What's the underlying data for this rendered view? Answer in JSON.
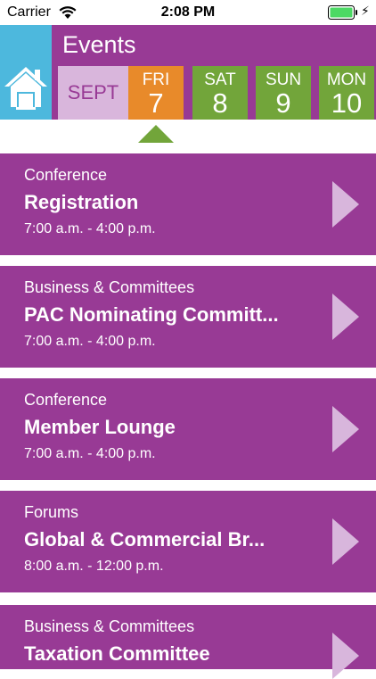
{
  "status_bar": {
    "carrier": "Carrier",
    "time": "2:08 PM"
  },
  "header": {
    "title": "Events",
    "home_icon": "home-icon"
  },
  "date_strip": {
    "month": "SEPT",
    "days": [
      {
        "dow": "FRI",
        "num": "7",
        "color": "#e88a2a",
        "selected": true
      },
      {
        "dow": "SAT",
        "num": "8",
        "color": "#72a53a",
        "selected": false
      },
      {
        "dow": "SUN",
        "num": "9",
        "color": "#72a53a",
        "selected": false
      },
      {
        "dow": "MON",
        "num": "10",
        "color": "#72a53a",
        "selected": false
      }
    ]
  },
  "events": [
    {
      "category": "Conference",
      "title": "Registration",
      "time": "7:00 a.m. - 4:00 p.m."
    },
    {
      "category": "Business & Committees",
      "title": "PAC Nominating Committ...",
      "time": "7:00 a.m. - 4:00 p.m."
    },
    {
      "category": "Conference",
      "title": "Member Lounge",
      "time": "7:00 a.m. - 4:00 p.m."
    },
    {
      "category": "Forums",
      "title": "Global  &  Commercial Br...",
      "time": "8:00 a.m. - 12:00 p.m."
    },
    {
      "category": "Business & Committees",
      "title": "Taxation Committee",
      "time": ""
    }
  ],
  "colors": {
    "purple": "#983a95",
    "light_purple": "#d9b6dc",
    "home_blue": "#4db8dd",
    "selected_orange": "#e88a2a",
    "day_green": "#72a53a"
  }
}
